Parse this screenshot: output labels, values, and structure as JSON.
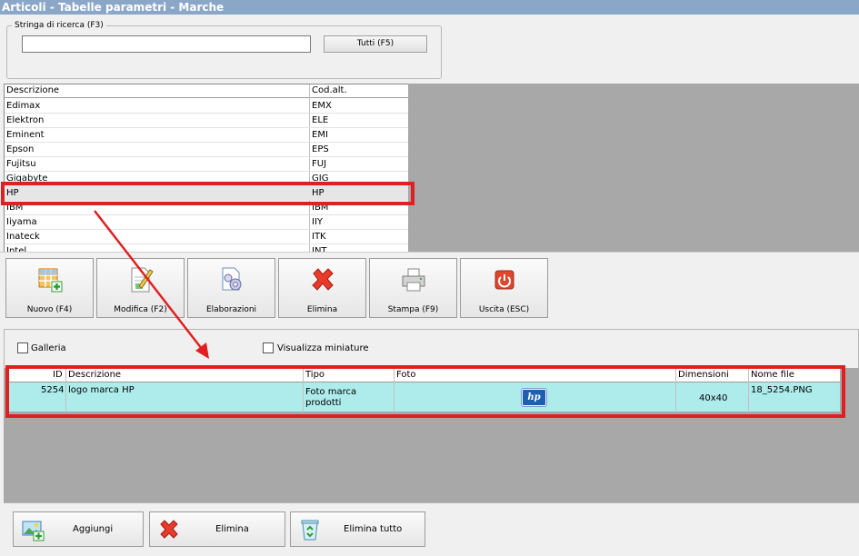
{
  "window": {
    "title": "Articoli - Tabelle parametri - Marche"
  },
  "search": {
    "legend": "Stringa di ricerca (F3)",
    "value": "",
    "tutti_label": "Tutti (F5)"
  },
  "brands": {
    "columns": [
      "Descrizione",
      "Cod.alt."
    ],
    "rows": [
      {
        "desc": "Edimax",
        "cod": "EMX"
      },
      {
        "desc": "Elektron",
        "cod": "ELE"
      },
      {
        "desc": "Eminent",
        "cod": "EMI"
      },
      {
        "desc": "Epson",
        "cod": "EPS"
      },
      {
        "desc": "Fujitsu",
        "cod": "FUJ"
      },
      {
        "desc": "Gigabyte",
        "cod": "GIG"
      },
      {
        "desc": "HP",
        "cod": "HP"
      },
      {
        "desc": "IBM",
        "cod": "IBM"
      },
      {
        "desc": "Iiyama",
        "cod": "IIY"
      },
      {
        "desc": "Inateck",
        "cod": "ITK"
      },
      {
        "desc": "Intel",
        "cod": "INT"
      }
    ],
    "selected_index": 6
  },
  "toolbar": {
    "nuovo": "Nuovo (F4)",
    "modifica": "Modifica (F2)",
    "elaborazioni": "Elaborazioni",
    "elimina": "Elimina",
    "stampa": "Stampa (F9)",
    "uscita": "Uscita (ESC)"
  },
  "gallery": {
    "galleria_label": "Galleria",
    "miniature_label": "Visualizza miniature",
    "galleria_checked": false,
    "miniature_checked": false,
    "columns": [
      "ID",
      "Descrizione",
      "Tipo",
      "Foto",
      "Dimensioni",
      "Nome file"
    ],
    "rows": [
      {
        "id": "5254",
        "desc": "logo marca HP",
        "tipo_line1": "Foto marca",
        "tipo_line2": "prodotti",
        "foto_logo": "hp",
        "dim": "40x40",
        "file": "18_5254.PNG"
      }
    ]
  },
  "bottom": {
    "aggiungi": "Aggiungi",
    "elimina": "Elimina",
    "elimina_tutto": "Elimina tutto"
  },
  "colors": {
    "highlight": "#e02020",
    "selected_row": "#aeecec",
    "title_bar": "#8aa7c8"
  }
}
